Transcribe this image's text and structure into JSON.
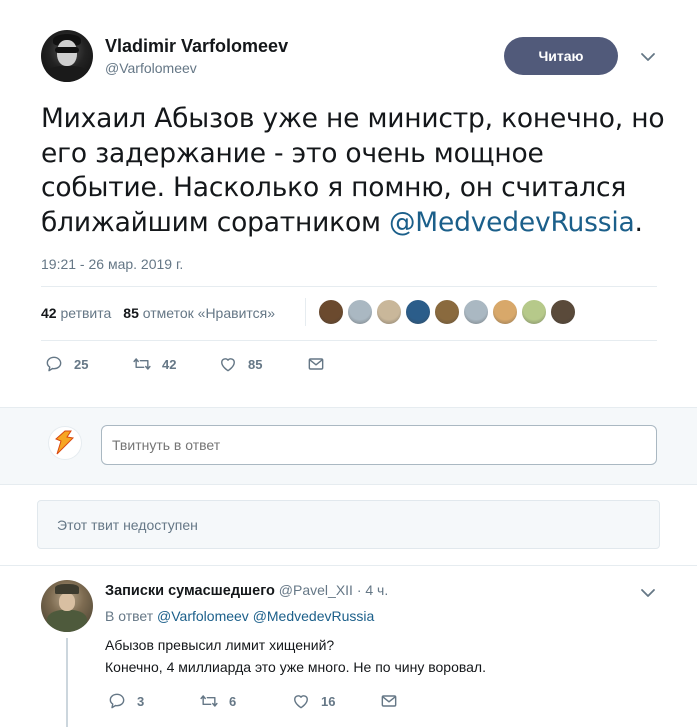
{
  "tweet": {
    "author_name": "Vladimir Varfolomeev",
    "author_handle": "@Varfolomeev",
    "follow_label": "Читаю",
    "text_before": "Михаил Абызов уже не министр, конечно, но его задержание - это очень мощное событие. Насколько я помню, он считался ближайшим соратником ",
    "mention": "@MedvedevRussia",
    "text_after": ".",
    "timestamp": "19:21 - 26 мар. 2019 г.",
    "retweets_count": "42",
    "retweets_label": "ретвита",
    "likes_count": "85",
    "likes_label": "отметок «Нравится»",
    "liker_colors": [
      "#6b4a2e",
      "#aab8c2",
      "#c9b79a",
      "#2b5d8a",
      "#8a6a3e",
      "#aab8c2",
      "#d8a86a",
      "#b6c98a",
      "#5a4a3a"
    ],
    "actions": {
      "reply_count": "25",
      "retweet_count": "42",
      "like_count": "85"
    }
  },
  "reply_box": {
    "placeholder": "Твитнуть в ответ"
  },
  "unavailable_text": "Этот твит недоступен",
  "reply": {
    "name": "Записки сумасшедшего",
    "handle": "@Pavel_XII",
    "time": " · 4 ч.",
    "reply_to_prefix": "В ответ ",
    "reply_to_1": "@Varfolomeev",
    "reply_to_2": "@MedvedevRussia",
    "line1": "Абызов превысил лимит хищений?",
    "line2": "Конечно, 4 миллиарда это уже много. Не по чину воровал.",
    "actions": {
      "reply_count": "3",
      "retweet_count": "6",
      "like_count": "16"
    }
  },
  "colors": {
    "accent": "#1b5f8a",
    "follow_button": "#515a7a",
    "muted_text": "#657786",
    "icon": "#657786"
  }
}
